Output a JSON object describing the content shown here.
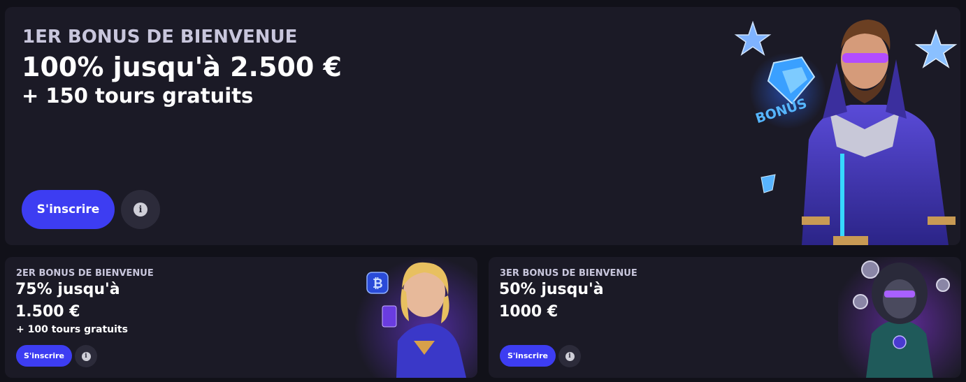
{
  "bonuses": {
    "first": {
      "eyebrow": "1ER BONUS DE BIENVENUE",
      "title": "100% jusqu'à 2.500 €",
      "subtitle": "+ 150 tours gratuits",
      "cta_label": "S'inscrire",
      "info_icon": "info-icon",
      "art_label": "BONUS"
    },
    "second": {
      "eyebrow": "2ER BONUS DE BIENVENUE",
      "title_line1": "75% jusqu'à",
      "title_line2": "1.500 €",
      "subtitle": "+ 100 tours gratuits",
      "cta_label": "S'inscrire",
      "info_icon": "info-icon"
    },
    "third": {
      "eyebrow": "3ER BONUS DE BIENVENUE",
      "title_line1": "50% jusqu'à",
      "title_line2": "1000 €",
      "cta_label": "S'inscrire",
      "info_icon": "info-icon"
    }
  },
  "colors": {
    "page_bg": "#111119",
    "card_bg": "#1b1a26",
    "accent": "#3d3df2",
    "info_bg": "#2c2b3a"
  }
}
